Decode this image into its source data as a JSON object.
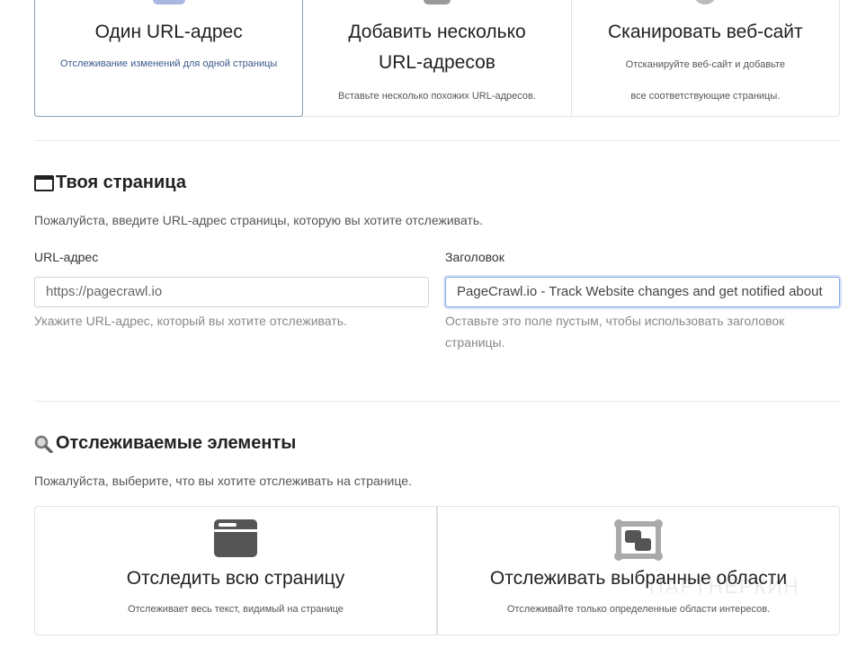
{
  "modes": [
    {
      "title": "Один URL-адрес",
      "desc": "Отслеживание изменений для одной страницы",
      "icon": "single-url-icon",
      "active": true
    },
    {
      "title": "Добавить несколько URL-адресов",
      "desc": "Вставьте несколько похожих URL-адресов.",
      "icon": "multiple-urls-icon"
    },
    {
      "title": "Сканировать веб-сайт",
      "desc": "Отсканируйте веб-сайт и добавьте все соответствующие страницы.",
      "icon": "crawl-icon"
    }
  ],
  "page_section": {
    "title": "Твоя страница",
    "icon": "browser-window-icon",
    "intro": "Пожалуйста, введите URL-адрес страницы, которую вы хотите отслеживать.",
    "url": {
      "label": "URL-адрес",
      "value": "https://pagecrawl.io",
      "help": "Укажите URL-адрес, который вы хотите отслеживать."
    },
    "title_field": {
      "label": "Заголовок",
      "value": "PageCrawl.io - Track Website changes and get notified about",
      "help": "Оставьте это поле пустым, чтобы использовать заголовок страницы."
    }
  },
  "tracked_section": {
    "title": "Отслеживаемые элементы",
    "icon": "magnifier-icon",
    "intro": "Пожалуйста, выберите, что вы хотите отслеживать на странице.",
    "options": [
      {
        "title": "Отследить всю страницу",
        "desc": "Отслеживает весь текст, видимый на странице",
        "icon": "full-page-icon"
      },
      {
        "title": "Отслеживать выбранные области",
        "desc": "Отслеживайте только определенные области интересов.",
        "icon": "selected-areas-icon"
      }
    ]
  },
  "watermark": "ПАРТНЕРКИН",
  "colors": {
    "active_border": "#8a9bb0",
    "focus_border": "#80a7e0"
  }
}
